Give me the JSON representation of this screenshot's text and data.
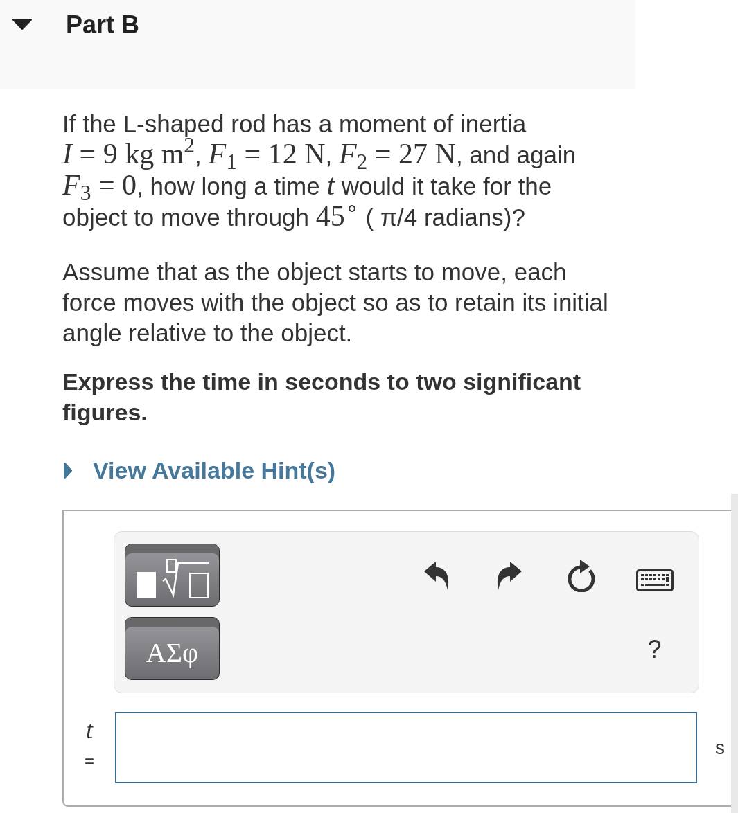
{
  "part": {
    "title": "Part B",
    "expanded": true
  },
  "question": {
    "segments": [
      {
        "kind": "text",
        "text": "If the L-shaped rod has a moment of inertia "
      },
      {
        "kind": "math",
        "text": "*I* = 9 kg m$^{2}$"
      },
      {
        "kind": "text",
        "text": ", "
      },
      {
        "kind": "math",
        "text": "*F*$_{1}$ = 12 N"
      },
      {
        "kind": "text",
        "text": ", "
      },
      {
        "kind": "math",
        "text": "*F*$_{2}$ = 27 N"
      },
      {
        "kind": "text",
        "text": ", and again "
      },
      {
        "kind": "math",
        "text": "*F*$_{3}$ = 0"
      },
      {
        "kind": "text",
        "text": ", how long a time "
      },
      {
        "kind": "math",
        "text": "*t*"
      },
      {
        "kind": "text",
        "text": " would it take for the object to move through "
      },
      {
        "kind": "math",
        "text": "45$^{∘}$"
      },
      {
        "kind": "text",
        "text": " ( π/4 radians)?"
      }
    ]
  },
  "assumption": "Assume that as the object starts to move, each force moves with the object so as to retain its initial angle relative to the object.",
  "instruction": "Express the time in seconds to two significant figures.",
  "hint": {
    "label": "View Available Hint(s)",
    "expanded": false
  },
  "toolbar": {
    "symbols_button": "ΑΣφ",
    "help_button": "?"
  },
  "answer": {
    "variable": "t",
    "relation": "=",
    "unit": "s"
  }
}
